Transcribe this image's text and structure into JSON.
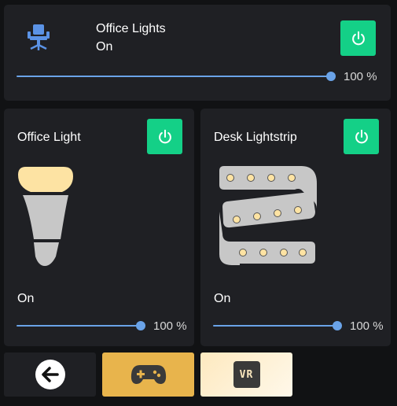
{
  "group": {
    "title": "Office Lights",
    "state": "On",
    "brightness": 100,
    "brightness_label": "100 %",
    "icon": "office-chair-icon"
  },
  "lights": [
    {
      "title": "Office Light",
      "state": "On",
      "brightness": 100,
      "brightness_label": "100 %",
      "icon": "bulb-icon"
    },
    {
      "title": "Desk Lightstrip",
      "state": "On",
      "brightness": 100,
      "brightness_label": "100 %",
      "icon": "lightstrip-icon"
    }
  ],
  "nav": {
    "back_icon": "back-arrow-icon",
    "game_icon": "gamepad-icon",
    "vr_label": "VR"
  },
  "colors": {
    "accent_green": "#14d087",
    "slider_blue": "#6aa3e8",
    "card_bg": "#1f2024",
    "gold": "#e8b44c",
    "cream": "#fde9bf"
  }
}
